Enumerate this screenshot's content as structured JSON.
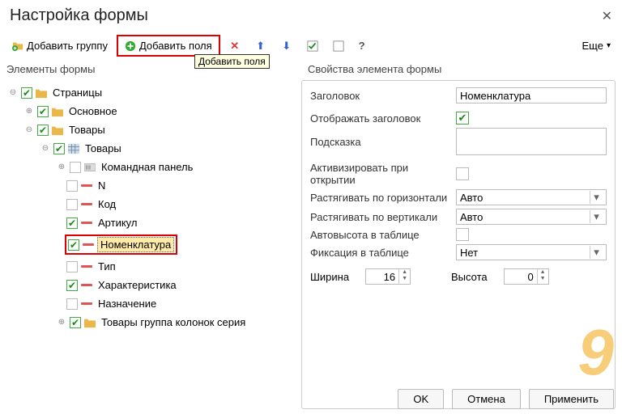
{
  "window": {
    "title": "Настройка формы"
  },
  "toolbar": {
    "add_group": "Добавить группу",
    "add_fields": "Добавить поля",
    "tooltip": "Добавить поля",
    "more": "Еще"
  },
  "left_panel_title": "Элементы формы",
  "right_panel_title": "Свойства элемента формы",
  "tree": {
    "pages": "Страницы",
    "main": "Основное",
    "goods": "Товары",
    "goods_table": "Товары",
    "cmd_panel": "Командная панель",
    "n": "N",
    "code": "Код",
    "article": "Артикул",
    "nomenclature": "Номенклатура",
    "type": "Тип",
    "characteristic": "Характеристика",
    "purpose": "Назначение",
    "series_group": "Товары группа колонок серия"
  },
  "props": {
    "header_label": "Заголовок",
    "header_value": "Номенклатура",
    "show_header": "Отображать заголовок",
    "hint": "Подсказка",
    "activate_on_open": "Активизировать при открытии",
    "stretch_h": "Растягивать по горизонтали",
    "stretch_h_val": "Авто",
    "stretch_v": "Растягивать по вертикали",
    "stretch_v_val": "Авто",
    "autoheight": "Автовысота в таблице",
    "fixation": "Фиксация в таблице",
    "fixation_val": "Нет",
    "width_label": "Ширина",
    "width_val": "16",
    "height_label": "Высота",
    "height_val": "0"
  },
  "footer": {
    "ok": "OK",
    "cancel": "Отмена",
    "apply": "Применить"
  }
}
